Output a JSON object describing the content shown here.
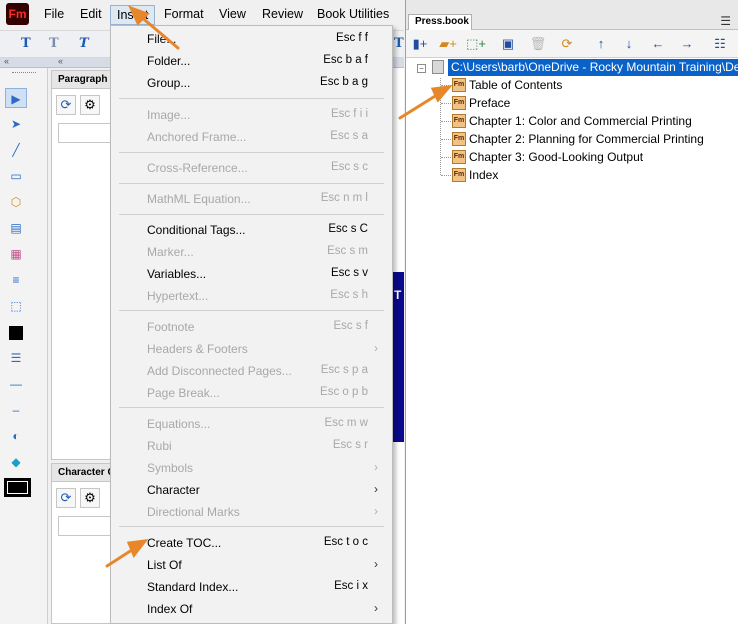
{
  "app": {
    "logo_text": "Fm"
  },
  "menubar": {
    "file": "File",
    "edit": "Edit",
    "insert": "Insert",
    "format": "Format",
    "view": "View",
    "review": "Review",
    "book_utilities": "Book Utilities"
  },
  "toolbar": {
    "t1": "T",
    "t2": "T",
    "t3": "T",
    "t4": "T"
  },
  "panels": {
    "paragraph_title": "Paragraph",
    "character_title": "Character C"
  },
  "document": {
    "visible_text": "T"
  },
  "insert_menu": {
    "items": [
      {
        "label": "File...",
        "shortcut": "Esc f f",
        "enabled": true
      },
      {
        "label": "Folder...",
        "shortcut": "Esc b a f",
        "enabled": true
      },
      {
        "label": "Group...",
        "shortcut": "Esc b a g",
        "enabled": true
      },
      {
        "label": "Image...",
        "shortcut": "Esc f i i",
        "enabled": false
      },
      {
        "label": "Anchored Frame...",
        "shortcut": "Esc s a",
        "enabled": false
      },
      {
        "label": "Cross-Reference...",
        "shortcut": "Esc s c",
        "enabled": false
      },
      {
        "label": "MathML Equation...",
        "shortcut": "Esc n m l",
        "enabled": false
      },
      {
        "label": "Conditional Tags...",
        "shortcut": "Esc s C",
        "enabled": true
      },
      {
        "label": "Marker...",
        "shortcut": "Esc s m",
        "enabled": false
      },
      {
        "label": "Variables...",
        "shortcut": "Esc s v",
        "enabled": true
      },
      {
        "label": "Hypertext...",
        "shortcut": "Esc s h",
        "enabled": false
      },
      {
        "label": "Footnote",
        "shortcut": "Esc s f",
        "enabled": false
      },
      {
        "label": "Headers & Footers",
        "shortcut": "",
        "enabled": false,
        "submenu": true
      },
      {
        "label": "Add Disconnected Pages...",
        "shortcut": "Esc s p a",
        "enabled": false
      },
      {
        "label": "Page Break...",
        "shortcut": "Esc o p b",
        "enabled": false
      },
      {
        "label": "Equations...",
        "shortcut": "Esc m w",
        "enabled": false
      },
      {
        "label": "Rubi",
        "shortcut": "Esc s r",
        "enabled": false
      },
      {
        "label": "Symbols",
        "shortcut": "",
        "enabled": false,
        "submenu": true
      },
      {
        "label": "Character",
        "shortcut": "",
        "enabled": true,
        "submenu": true
      },
      {
        "label": "Directional Marks",
        "shortcut": "",
        "enabled": false,
        "submenu": true
      },
      {
        "label": "Create TOC...",
        "shortcut": "Esc t o c",
        "enabled": true
      },
      {
        "label": "List Of",
        "shortcut": "",
        "enabled": true,
        "submenu": true
      },
      {
        "label": "Standard Index...",
        "shortcut": "Esc i x",
        "enabled": true
      },
      {
        "label": "Index Of",
        "shortcut": "",
        "enabled": true,
        "submenu": true
      }
    ]
  },
  "book": {
    "tab_title": "Press.book",
    "path": "C:\\Users\\barb\\OneDrive - Rocky Mountain Training\\Deskto",
    "files": [
      {
        "name": "Table of Contents"
      },
      {
        "name": "Preface"
      },
      {
        "name": "Chapter 1: Color and Commercial Printing"
      },
      {
        "name": "Chapter 2: Planning for Commercial Printing"
      },
      {
        "name": "Chapter 3: Good-Looking Output"
      },
      {
        "name": "Index"
      }
    ],
    "file_icon_text": "Fm"
  },
  "colors": {
    "accent_highlight": "#0a62c8",
    "annotation_arrow": "#e8872a",
    "logo_bg": "#330000",
    "logo_fg": "#ff2a2a"
  }
}
